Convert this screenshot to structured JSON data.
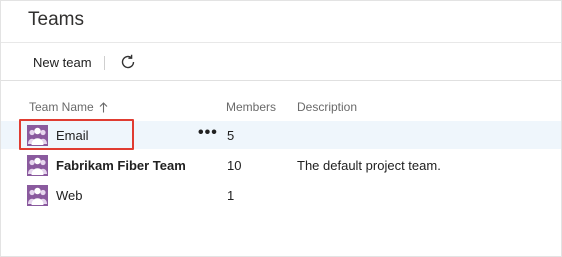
{
  "page": {
    "title": "Teams"
  },
  "toolbar": {
    "new_team_label": "New team",
    "refresh_icon": "refresh-icon"
  },
  "table": {
    "headers": {
      "name": "Team Name",
      "name_sort_icon": "sort-ascending-icon",
      "members": "Members",
      "description": "Description"
    },
    "rows": [
      {
        "name": "Email",
        "members": "5",
        "description": "",
        "more": "•••",
        "selected": true,
        "bold": false
      },
      {
        "name": "Fabrikam Fiber Team",
        "members": "10",
        "description": "The default project team.",
        "selected": false,
        "bold": true
      },
      {
        "name": "Web",
        "members": "1",
        "description": "",
        "selected": false,
        "bold": false
      }
    ]
  },
  "colors": {
    "team_icon": "#8a5a9e",
    "selected_row": "#eff6fc",
    "highlight_border": "#e03c31"
  }
}
